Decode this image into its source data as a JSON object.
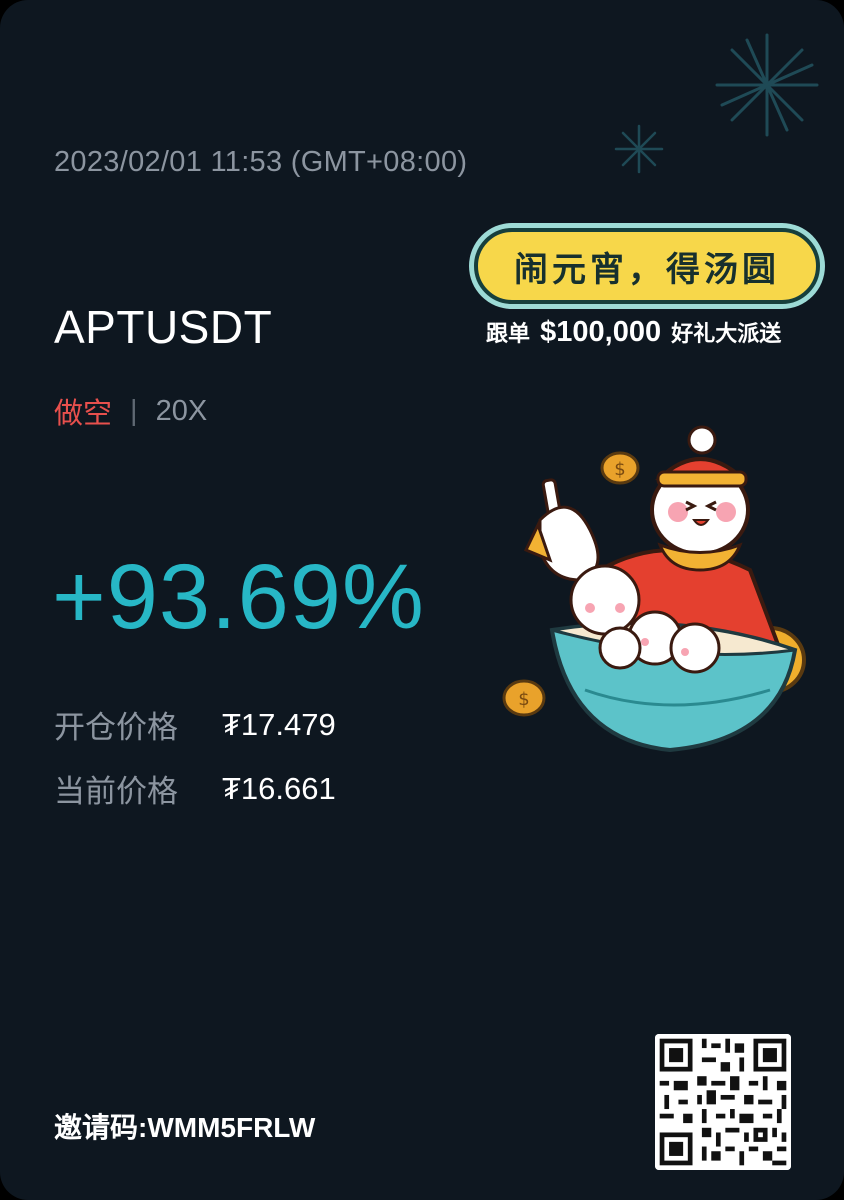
{
  "timestamp": "2023/02/01 11:53 (GMT+08:00)",
  "symbol": "APTUSDT",
  "position": {
    "side": "做空",
    "separator": "|",
    "leverage": "20X"
  },
  "roi": "+93.69%",
  "prices": [
    {
      "label": "开仓价格",
      "value": "₮17.479"
    },
    {
      "label": "当前价格",
      "value": "₮16.661"
    }
  ],
  "promo": {
    "title": "闹元宵，得汤圆",
    "subtitle_prefix": "跟单",
    "subtitle_amount": "$100,000",
    "subtitle_suffix": "好礼大派送"
  },
  "invite": "邀请码:WMM5FRLW",
  "colors": {
    "background": "#0e1720",
    "profit": "#27b7c6",
    "short": "#e8504d",
    "muted": "#8c95a0"
  },
  "icons": [
    "firework-icon",
    "rabbit-illustration",
    "coin-icon",
    "qr-code"
  ]
}
